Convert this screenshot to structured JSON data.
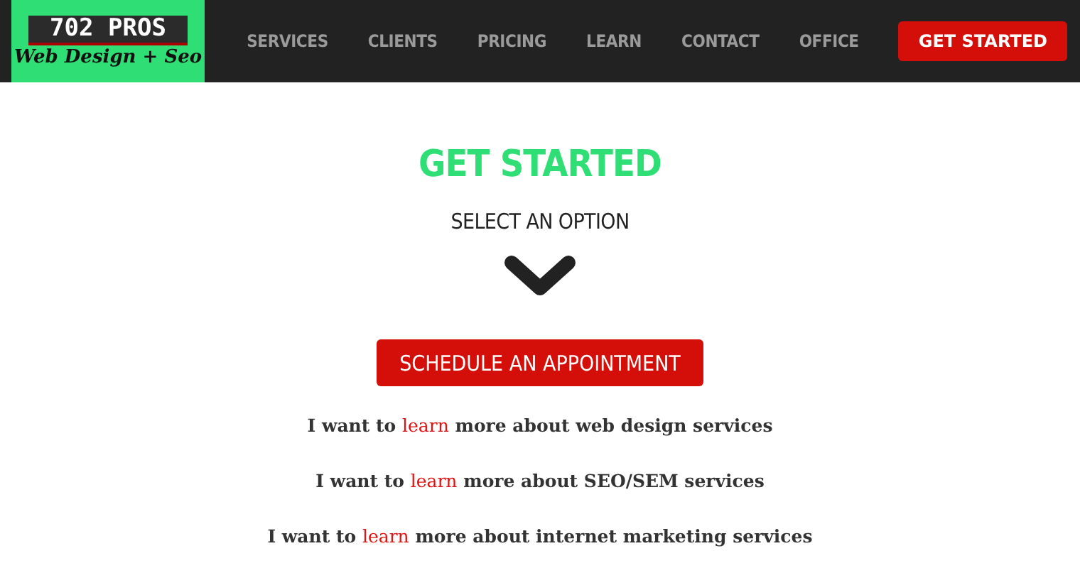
{
  "logo": {
    "top": "702 PROS",
    "bottom": "Web Design + Seo"
  },
  "nav": [
    {
      "label": "SERVICES"
    },
    {
      "label": "CLIENTS"
    },
    {
      "label": "PRICING"
    },
    {
      "label": "LEARN"
    },
    {
      "label": "CONTACT"
    },
    {
      "label": "OFFICE"
    }
  ],
  "nav_button": "GET STARTED",
  "heading": "GET STARTED",
  "subheading": "SELECT AN OPTION",
  "cta_button": "SCHEDULE AN APPOINTMENT",
  "options": [
    {
      "before": "I want to ",
      "link": "learn",
      "after": " more about web design services"
    },
    {
      "before": "I want to ",
      "link": "learn",
      "after": " more about SEO/SEM services"
    },
    {
      "before": "I want to ",
      "link": "learn",
      "after": " more about internet marketing services"
    }
  ]
}
